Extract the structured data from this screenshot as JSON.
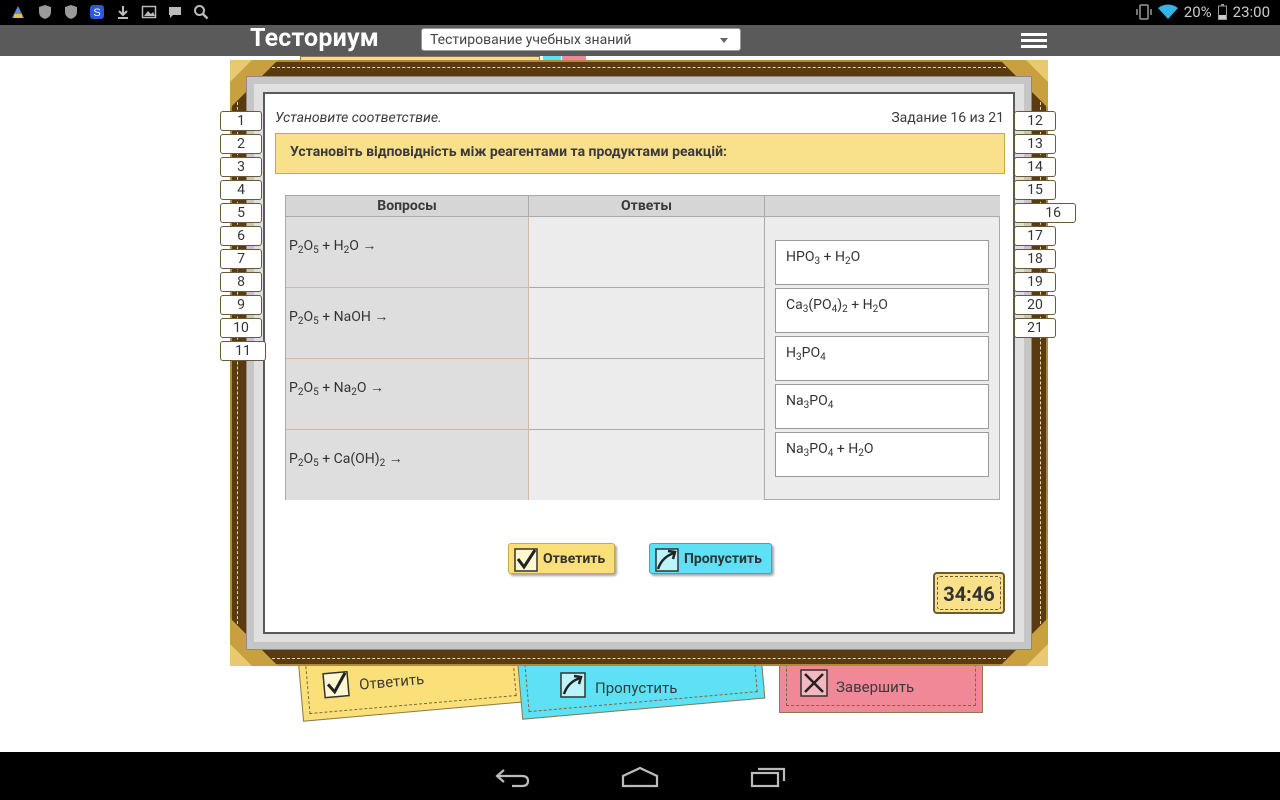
{
  "status_bar": {
    "battery_percent": "20%",
    "time": "23:00"
  },
  "app": {
    "title": "Тесториум",
    "dropdown_value": "Тестирование учебных знаний"
  },
  "background_cards": {
    "answer_label": "Ответить",
    "skip_label": "Пропустить",
    "finish_label": "Завершить"
  },
  "task": {
    "instruction": "Установите соответствие.",
    "counter": "Задание 16 из 21",
    "question": "Установіть відповідність між реагентами та продуктами реакцій:"
  },
  "table": {
    "col_questions": "Вопросы",
    "col_answers": "Ответы",
    "questions": [
      {
        "main": "P",
        "parts": [
          [
            "P",
            "2"
          ],
          [
            "O",
            "5"
          ],
          [
            " + H",
            "2"
          ],
          [
            "O →",
            ""
          ]
        ],
        "text": "P2O5 + H2O →"
      },
      {
        "text": "P2O5 + NaOH →"
      },
      {
        "text": "P2O5 + Na2O →"
      },
      {
        "text": "P2O5 + Ca(OH)2 →"
      }
    ],
    "options": [
      {
        "text": "HPO3 + H2O"
      },
      {
        "text": "Ca3(PO4)2 + H2O"
      },
      {
        "text": "H3PO4"
      },
      {
        "text": "Na3PO4"
      },
      {
        "text": "Na3PO4 + H2O"
      }
    ]
  },
  "buttons": {
    "answer": "Ответить",
    "skip": "Пропустить"
  },
  "timer": "34:46",
  "task_numbers_left": [
    "1",
    "2",
    "3",
    "4",
    "5",
    "6",
    "7",
    "8",
    "9",
    "10",
    "11"
  ],
  "task_numbers_right": [
    "12",
    "13",
    "14",
    "15",
    "16",
    "17",
    "18",
    "19",
    "20",
    "21"
  ],
  "current_task": "16",
  "colors": {
    "frame_brown": "#5a3a10",
    "question_yellow": "#f9e08a",
    "skip_cyan": "#5ee0f5",
    "finish_pink": "#f08898"
  }
}
